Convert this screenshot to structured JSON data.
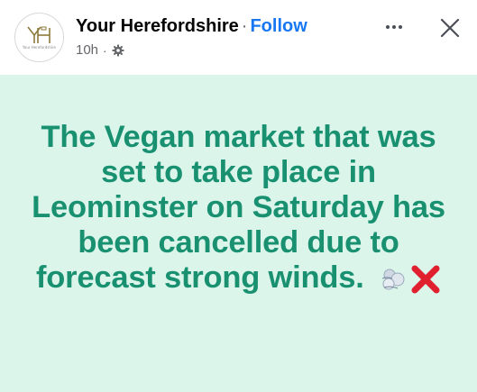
{
  "post": {
    "page_name": "Your Herefordshire",
    "separator": "·",
    "follow_label": "Follow",
    "time": "10h",
    "meta_separator": "·",
    "avatar": {
      "monogram": "YH",
      "tagline": "Your Herefordshire",
      "color": "#8c7a3a"
    },
    "body_text": "The Vegan market that was set to take place in Leominster on Saturday has been cancelled due to forecast strong winds.",
    "emojis": [
      "wind-face-icon",
      "cross-mark-icon"
    ]
  },
  "colors": {
    "card_background": "#dbf5eb",
    "text": "#199171",
    "follow": "#1877f2",
    "cross": "#e0202e"
  }
}
